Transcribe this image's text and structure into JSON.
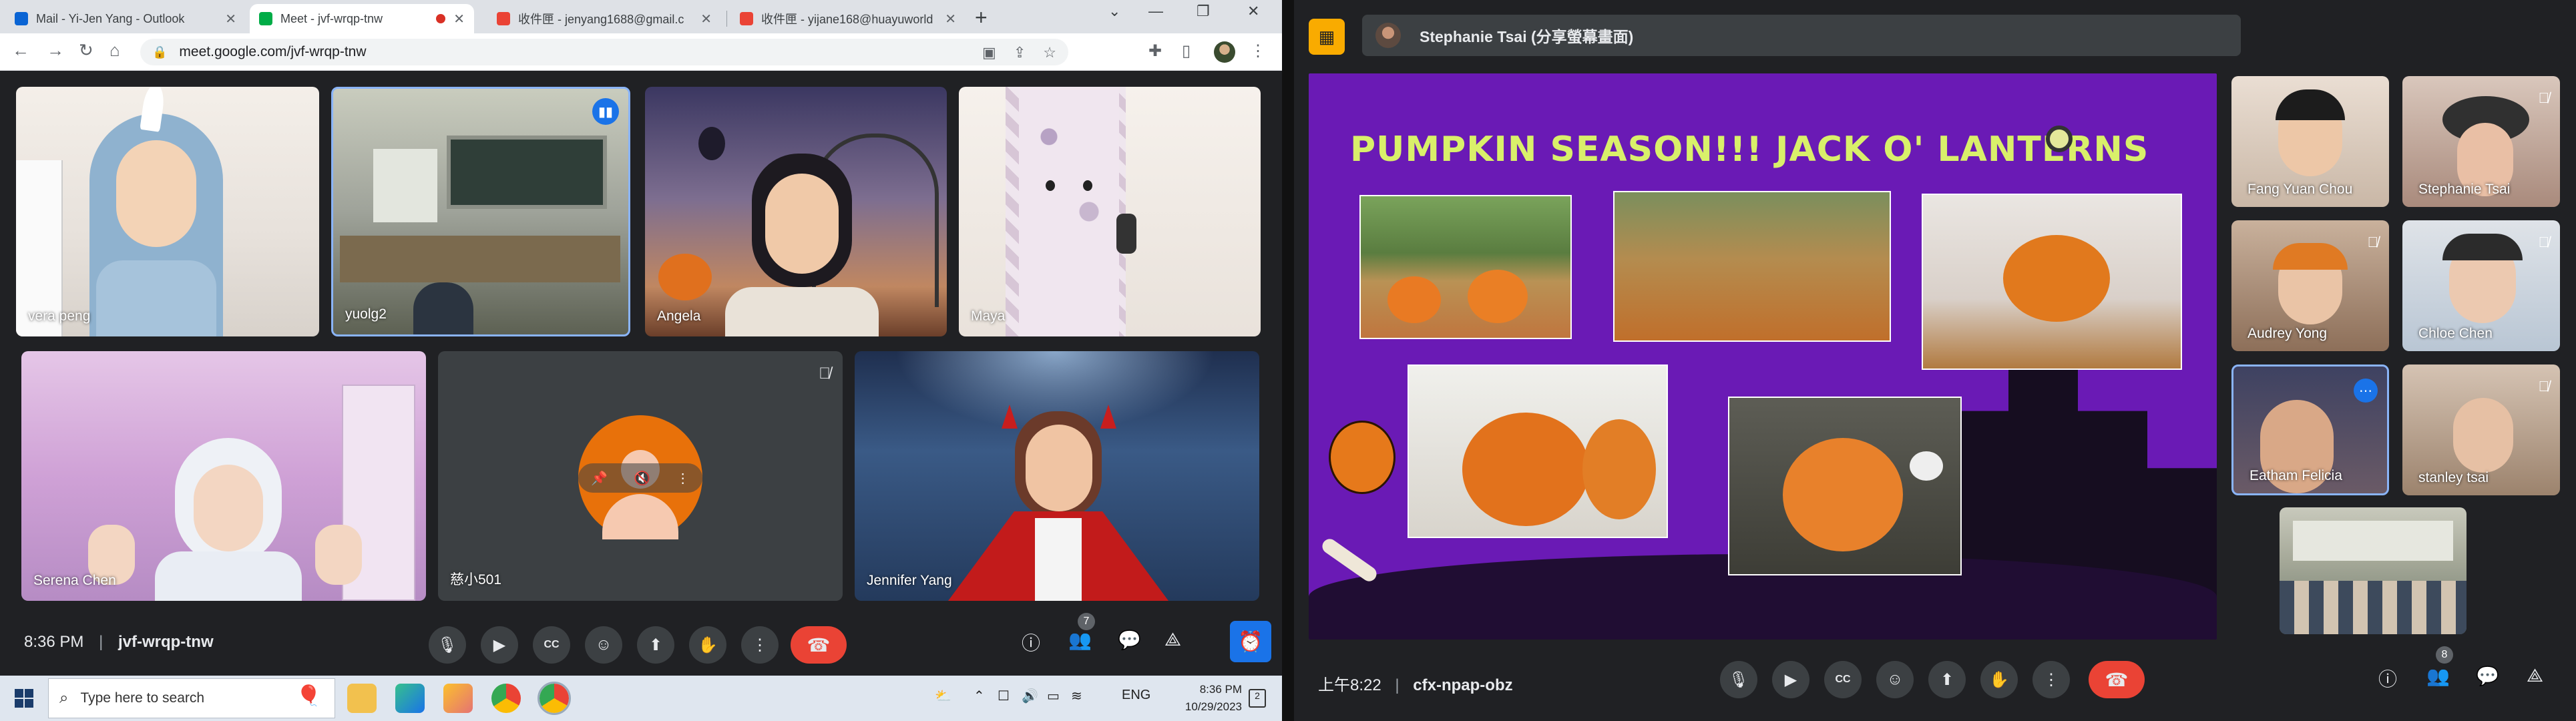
{
  "left": {
    "tabs": [
      {
        "label": "Mail - Yi-Jen Yang - Outlook",
        "favicon_color": "#0a64d4"
      },
      {
        "label": "Meet - jvf-wrqp-tnw",
        "favicon_color": "#00ac47",
        "active": true
      },
      {
        "label": "收件匣 - jenyang1688@gmail.c",
        "favicon_color": "#ea4335"
      },
      {
        "label": "收件匣 - yijane168@huayuworld",
        "favicon_color": "#ea4335"
      }
    ],
    "url": "meet.google.com/jvf-wrqp-tnw",
    "participants": [
      {
        "name": "vera peng"
      },
      {
        "name": "yuolg2"
      },
      {
        "name": "Angela"
      },
      {
        "name": "Maya"
      },
      {
        "name": "Serena Chen"
      },
      {
        "name": "慈小501"
      },
      {
        "name": "Jennifer Yang"
      }
    ],
    "meeting_time": "8:36 PM",
    "meeting_code": "jvf-wrqp-tnw",
    "participants_count": "7",
    "taskbar": {
      "search_placeholder": "Type here to search",
      "lang": "ENG",
      "clock_time": "8:36 PM",
      "clock_date": "10/29/2023",
      "notif_count": "2"
    }
  },
  "right": {
    "presenter": "Stephanie Tsai (分享螢幕畫面)",
    "slide_title": "PUMPKIN SEASON!!! JACK O' LANTERNS",
    "participants": [
      {
        "name": "Fang Yuan Chou"
      },
      {
        "name": "Stephanie Tsai"
      },
      {
        "name": "Audrey Yong"
      },
      {
        "name": "Chloe Chen"
      },
      {
        "name": "Eatham Felicia"
      },
      {
        "name": "stanley tsai"
      }
    ],
    "meeting_time": "上午8:22",
    "meeting_code": "cfx-npap-obz",
    "participants_count": "8"
  },
  "colors": {
    "meet_bg": "#202124",
    "control_bg": "#3c4043",
    "end_call": "#ea4335",
    "accent_blue": "#1a73e8",
    "slide_purple": "#6a1ab5",
    "slide_title": "#d9f06a"
  }
}
